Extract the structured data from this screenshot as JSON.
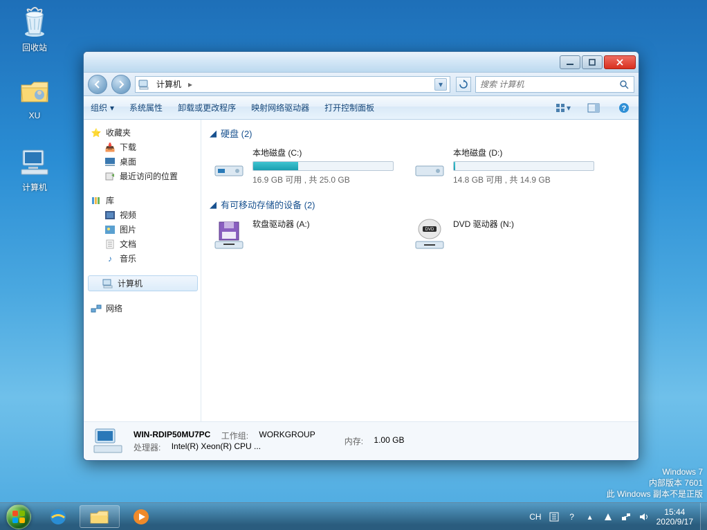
{
  "desktop": {
    "icons": [
      {
        "name": "recycle-bin",
        "label": "回收站"
      },
      {
        "name": "folder-xu",
        "label": "XU"
      },
      {
        "name": "computer",
        "label": "计算机"
      }
    ],
    "watermark": {
      "line1": "Windows 7",
      "line2": "内部版本 7601",
      "line3": "此 Windows 副本不是正版"
    }
  },
  "taskbar": {
    "ime": "CH",
    "clock_time": "15:44",
    "clock_date": "2020/9/17"
  },
  "window": {
    "breadcrumb": "计算机",
    "search_placeholder": "搜索 计算机",
    "commands": {
      "organize": "组织",
      "props": "系统属性",
      "uninstall": "卸载或更改程序",
      "netdrive": "映射网络驱动器",
      "ctrlpanel": "打开控制面板"
    },
    "nav": {
      "fav_hdr": "收藏夹",
      "fav": {
        "downloads": "下载",
        "desktop": "桌面",
        "recent": "最近访问的位置"
      },
      "lib_hdr": "库",
      "lib": {
        "videos": "视频",
        "pictures": "图片",
        "docs": "文档",
        "music": "音乐"
      },
      "computer": "计算机",
      "network": "网络"
    },
    "groups": {
      "hdd": {
        "label": "硬盘 (2)"
      },
      "removable": {
        "label": "有可移动存储的设备 (2)"
      }
    },
    "drives": {
      "c": {
        "name": "本地磁盘 (C:)",
        "sub": "16.9 GB 可用 , 共 25.0 GB",
        "fill_pct": 32
      },
      "d": {
        "name": "本地磁盘 (D:)",
        "sub": "14.8 GB 可用 , 共 14.9 GB",
        "fill_pct": 1
      },
      "a": {
        "name": "软盘驱动器 (A:)"
      },
      "n": {
        "name": "DVD 驱动器 (N:)"
      }
    },
    "details": {
      "name": "WIN-RDIP50MU7PC",
      "workgroup_k": "工作组:",
      "workgroup_v": "WORKGROUP",
      "cpu_k": "处理器:",
      "cpu_v": "Intel(R) Xeon(R) CPU ...",
      "mem_k": "内存:",
      "mem_v": "1.00 GB"
    }
  }
}
